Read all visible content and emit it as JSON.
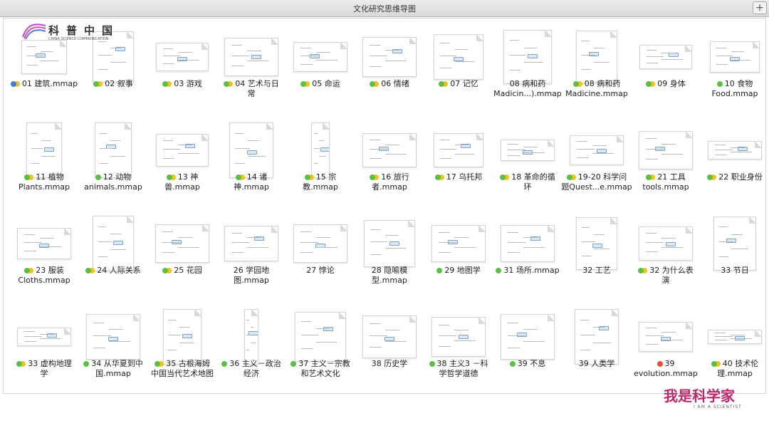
{
  "window": {
    "title": "文化研究思维导图",
    "add_label": "+"
  },
  "colors": {
    "blue": "#3c7ed8",
    "green": "#5cbf45",
    "yellow": "#f4c21c",
    "red": "#e84c3d"
  },
  "watermark_top": {
    "name": "科普中国",
    "subtitle": "CHINA SCIENCE COMMUNICATION"
  },
  "watermark_bottom": {
    "name": "我是科学家",
    "subtitle": "I AM A SCIENTIST"
  },
  "items": [
    {
      "label": [
        "01 建筑.mmap"
      ],
      "tags": [
        "blue",
        "yellow"
      ]
    },
    {
      "label": [
        "02 叙事"
      ],
      "tags": [
        "green",
        "yellow"
      ]
    },
    {
      "label": [
        "03 游戏"
      ],
      "tags": [
        "green",
        "yellow"
      ]
    },
    {
      "label": [
        "04 艺术与日",
        "常"
      ],
      "tags": [
        "green",
        "yellow"
      ]
    },
    {
      "label": [
        "05 命运"
      ],
      "tags": [
        "green",
        "yellow"
      ]
    },
    {
      "label": [
        "06 情绪"
      ],
      "tags": [
        "green",
        "yellow"
      ]
    },
    {
      "label": [
        "07 记忆"
      ],
      "tags": [
        "green",
        "yellow"
      ]
    },
    {
      "label": [
        "08 病和药",
        "Madicin...).mmap"
      ],
      "tags": []
    },
    {
      "label": [
        "08 病和药",
        "Madicine.mmap"
      ],
      "tags": [
        "green",
        "yellow"
      ]
    },
    {
      "label": [
        "09 身体"
      ],
      "tags": [
        "green",
        "yellow"
      ]
    },
    {
      "label": [
        "10 食物",
        "Food.mmap"
      ],
      "tags": [
        "green"
      ]
    },
    {
      "label": [
        "11 植物",
        "Plants.mmap"
      ],
      "tags": [
        "green",
        "yellow"
      ]
    },
    {
      "label": [
        "12 动物",
        "animals.mmap"
      ],
      "tags": [
        "green"
      ]
    },
    {
      "label": [
        "13 神",
        "兽.mmap"
      ],
      "tags": [
        "green",
        "yellow"
      ]
    },
    {
      "label": [
        "14 诸",
        "神.mmap"
      ],
      "tags": [
        "green",
        "yellow"
      ]
    },
    {
      "label": [
        "15 宗",
        "教.mmap"
      ],
      "tags": [
        "green",
        "yellow"
      ]
    },
    {
      "label": [
        "16 旅行",
        "者.mmap"
      ],
      "tags": [
        "green",
        "yellow"
      ]
    },
    {
      "label": [
        "17 乌托邦"
      ],
      "tags": [
        "green",
        "yellow"
      ]
    },
    {
      "label": [
        "18 革命的循",
        "环"
      ],
      "tags": [
        "green",
        "yellow"
      ]
    },
    {
      "label": [
        "19-20 科学问",
        "题Quest...e.mmap"
      ],
      "tags": [
        "green",
        "yellow"
      ]
    },
    {
      "label": [
        "21 工具",
        "tools.mmap"
      ],
      "tags": [
        "green",
        "yellow"
      ]
    },
    {
      "label": [
        "22 职业身份"
      ],
      "tags": [
        "green",
        "yellow"
      ]
    },
    {
      "label": [
        "23 服装",
        "Cloths.mmap"
      ],
      "tags": [
        "green",
        "yellow"
      ]
    },
    {
      "label": [
        "24 人际关系"
      ],
      "tags": [
        "green",
        "yellow"
      ]
    },
    {
      "label": [
        "25  花园"
      ],
      "tags": [
        "green",
        "yellow"
      ]
    },
    {
      "label": [
        "26  学园地",
        "图.mmap"
      ],
      "tags": []
    },
    {
      "label": [
        "27 悖论"
      ],
      "tags": []
    },
    {
      "label": [
        "28 隐喻模",
        "型.mmap"
      ],
      "tags": []
    },
    {
      "label": [
        "29 地图学"
      ],
      "tags": [
        "green"
      ]
    },
    {
      "label": [
        "31 场所.mmap"
      ],
      "tags": [
        "green"
      ]
    },
    {
      "label": [
        "32 工艺"
      ],
      "tags": []
    },
    {
      "label": [
        "32 为什么表",
        "演"
      ],
      "tags": [
        "green",
        "yellow"
      ]
    },
    {
      "label": [
        "33 节日"
      ],
      "tags": []
    },
    {
      "label": [
        "33 虚构地理",
        "学"
      ],
      "tags": [
        "green",
        "yellow"
      ]
    },
    {
      "label": [
        "34 从华夏到中",
        "国.mmap"
      ],
      "tags": [
        "green"
      ]
    },
    {
      "label": [
        "35 古根海姆",
        "中国当代艺术地图"
      ],
      "tags": [
        "green",
        "yellow"
      ]
    },
    {
      "label": [
        "36 主义－政治",
        "经济"
      ],
      "tags": [
        "green"
      ]
    },
    {
      "label": [
        "37 主义－宗教",
        "和艺术文化"
      ],
      "tags": [
        "green"
      ]
    },
    {
      "label": [
        "38 历史学"
      ],
      "tags": []
    },
    {
      "label": [
        "38 主义3 －科",
        "学哲学道德"
      ],
      "tags": [
        "green"
      ]
    },
    {
      "label": [
        "39 不息"
      ],
      "tags": [
        "green"
      ]
    },
    {
      "label": [
        "39 人类学"
      ],
      "tags": []
    },
    {
      "label": [
        "39",
        "evolution.mmap"
      ],
      "tags": [
        "red"
      ]
    },
    {
      "label": [
        "40 技术伦",
        "理.mmap"
      ],
      "tags": [
        "green",
        "yellow"
      ]
    }
  ]
}
